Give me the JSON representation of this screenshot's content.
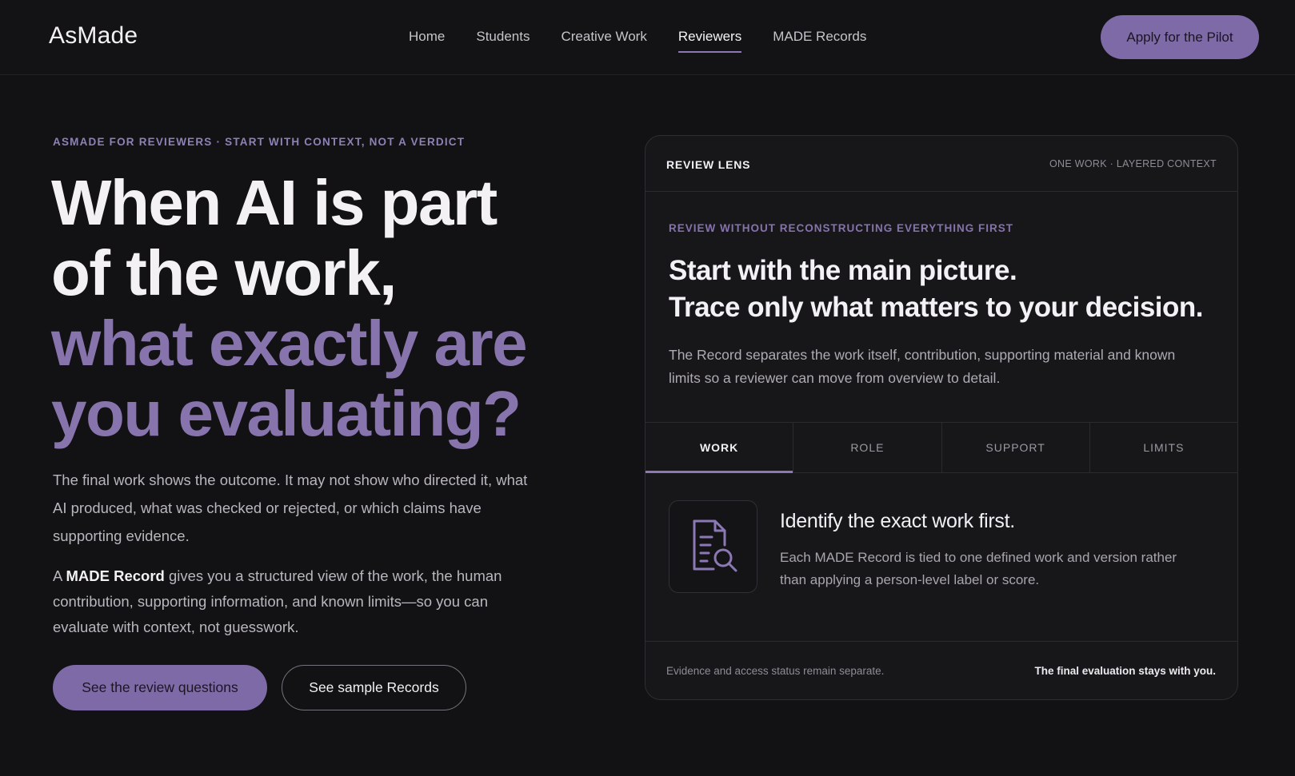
{
  "nav": {
    "logo": "AsMade",
    "links": [
      {
        "label": "Home",
        "active": false
      },
      {
        "label": "Students",
        "active": false
      },
      {
        "label": "Creative Work",
        "active": false
      },
      {
        "label": "Reviewers",
        "active": true
      },
      {
        "label": "MADE Records",
        "active": false
      }
    ],
    "cta": "Apply for the Pilot"
  },
  "hero": {
    "eyebrow": "ASMADE FOR REVIEWERS · START WITH CONTEXT, NOT A VERDICT",
    "headline_line1": "When AI is part",
    "headline_line2": "of the work,",
    "headline_line3": "what exactly are",
    "headline_line4": "you evaluating?",
    "paragraph1": "The final work shows the outcome. It may not show who directed it, what AI produced, what was checked or rejected, or which claims have supporting evidence.",
    "paragraph2_prefix": "A ",
    "paragraph2_bold": "MADE Record",
    "paragraph2_rest": " gives you a structured view of the work, the human contribution, supporting information, and known limits—so you can evaluate with context, not guesswork.",
    "primary_button": "See the review questions",
    "secondary_button": "See sample Records"
  },
  "card": {
    "title": "REVIEW LENS",
    "tag": "ONE WORK · LAYERED CONTEXT",
    "eyebrow": "REVIEW WITHOUT RECONSTRUCTING EVERYTHING FIRST",
    "headline_line1": "Start with the main picture.",
    "headline_line2": "Trace only what matters to your decision.",
    "description": "The Record separates the work itself, contribution, supporting material and known limits so a reviewer can move from overview to detail.",
    "tabs": [
      {
        "label": "WORK",
        "active": true
      },
      {
        "label": "ROLE",
        "active": false
      },
      {
        "label": "SUPPORT",
        "active": false
      },
      {
        "label": "LIMITS",
        "active": false
      }
    ],
    "panel_icon": "document-search-icon",
    "panel_title": "Identify the exact work first.",
    "panel_description": "Each MADE Record is tied to one defined work and version rather than applying a person-level label or score.",
    "footer_left": "Evidence and access status remain separate.",
    "footer_right": "The final evaluation stays with you."
  },
  "colors": {
    "accent": "#8874ad",
    "button_fill": "#7e6aa6",
    "background": "#121214"
  }
}
